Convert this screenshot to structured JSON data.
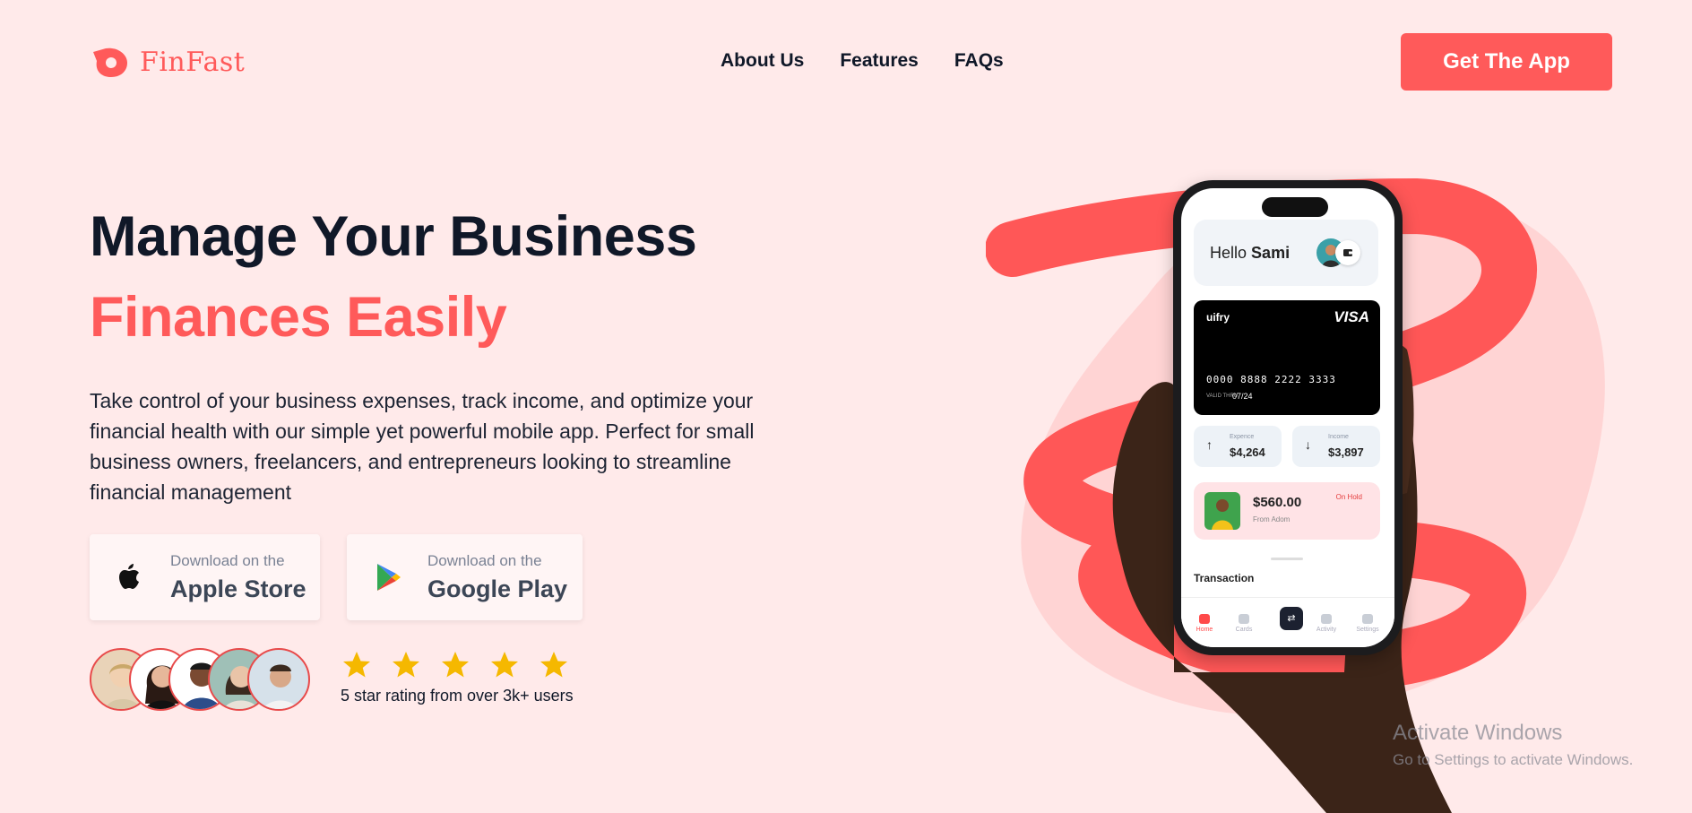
{
  "brand": {
    "name": "FinFast",
    "accent_color": "#ff5a5a",
    "icon": "finfast-logo-icon"
  },
  "nav": {
    "items": [
      {
        "label": "About Us"
      },
      {
        "label": "Features"
      },
      {
        "label": "FAQs"
      }
    ],
    "cta_label": "Get The App"
  },
  "hero": {
    "title_line1": "Manage Your Business",
    "title_line2": "Finances Easily",
    "description": "Take control of your business expenses, track income, and optimize your financial health with our simple yet powerful mobile app. Perfect for small business owners, freelancers, and entrepreneurs looking to streamline financial management",
    "apple": {
      "small": "Download on the",
      "big": "Apple Store",
      "icon": "apple-icon"
    },
    "google": {
      "small": "Download on the",
      "big": "Google Play",
      "icon": "google-play-icon"
    },
    "rating": {
      "stars": 5,
      "text": "5 star rating from over 3k+ users",
      "star_color": "#f5b800"
    }
  },
  "phone": {
    "greeting": "Hello",
    "user_name": "Sami",
    "card": {
      "brand": "uifry",
      "network": "VISA",
      "number": "0000 8888 2222 3333",
      "valid_label": "VALID THRU",
      "expiry": "07/24"
    },
    "expense": {
      "label": "Expence",
      "value": "$4,264"
    },
    "income": {
      "label": "Income",
      "value": "$3,897"
    },
    "pending": {
      "amount": "$560.00",
      "from": "From Adom",
      "status": "On Hold"
    },
    "section_title": "Transaction",
    "tabs": [
      {
        "label": "Home"
      },
      {
        "label": "Cards"
      },
      {
        "label": "Activity"
      },
      {
        "label": "Settings"
      }
    ]
  },
  "watermark": {
    "line1": "Activate Windows",
    "line2": "Go to Settings to activate Windows."
  }
}
